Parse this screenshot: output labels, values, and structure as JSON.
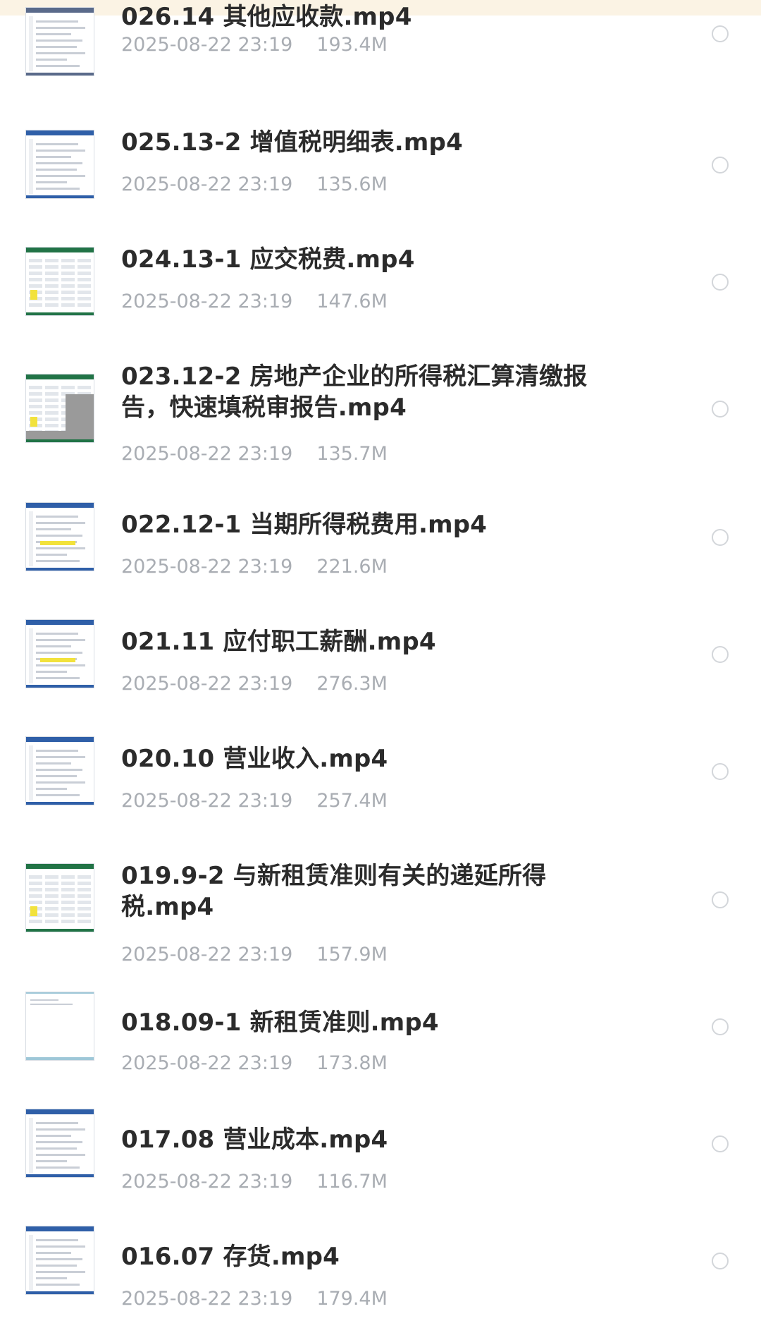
{
  "files": [
    {
      "name": "026.14 其他应收款.mp4",
      "date": "2025-08-22 23:19",
      "size": "193.4M",
      "thumb_accent": "#5a6a8a",
      "thumb_kind": "doc"
    },
    {
      "name": "025.13-2 增值税明细表.mp4",
      "date": "2025-08-22 23:19",
      "size": "135.6M",
      "thumb_accent": "#2f5fa8",
      "thumb_kind": "doc"
    },
    {
      "name": "024.13-1 应交税费.mp4",
      "date": "2025-08-22 23:19",
      "size": "147.6M",
      "thumb_accent": "#217346",
      "thumb_kind": "sheet"
    },
    {
      "name": "023.12-2 房地产企业的所得税汇算清缴报告，快速填税审报告.mp4",
      "date": "2025-08-22 23:19",
      "size": "135.7M",
      "thumb_accent": "#217346",
      "thumb_kind": "sheet-panel"
    },
    {
      "name": "022.12-1 当期所得税费用.mp4",
      "date": "2025-08-22 23:19",
      "size": "221.6M",
      "thumb_accent": "#2f5fa8",
      "thumb_kind": "doc-hl"
    },
    {
      "name": "021.11 应付职工薪酬.mp4",
      "date": "2025-08-22 23:19",
      "size": "276.3M",
      "thumb_accent": "#2f5fa8",
      "thumb_kind": "doc-hl"
    },
    {
      "name": "020.10 营业收入.mp4",
      "date": "2025-08-22 23:19",
      "size": "257.4M",
      "thumb_accent": "#2f5fa8",
      "thumb_kind": "doc"
    },
    {
      "name": "019.9-2 与新租赁准则有关的递延所得税.mp4",
      "date": "2025-08-22 23:19",
      "size": "157.9M",
      "thumb_accent": "#217346",
      "thumb_kind": "sheet"
    },
    {
      "name": "018.09-1 新租赁准则.mp4",
      "date": "2025-08-22 23:19",
      "size": "173.8M",
      "thumb_accent": "#9ec7d8",
      "thumb_kind": "blank"
    },
    {
      "name": "017.08 营业成本.mp4",
      "date": "2025-08-22 23:19",
      "size": "116.7M",
      "thumb_accent": "#2f5fa8",
      "thumb_kind": "doc"
    },
    {
      "name": "016.07 存货.mp4",
      "date": "2025-08-22 23:19",
      "size": "179.4M",
      "thumb_accent": "#2f5fa8",
      "thumb_kind": "doc"
    }
  ],
  "icons": {
    "thumbnail": "video-thumbnail-icon",
    "select": "radio-unchecked-icon"
  }
}
